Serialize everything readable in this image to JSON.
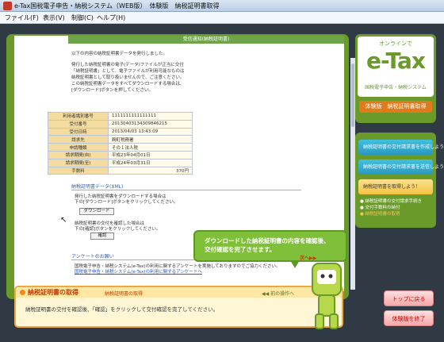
{
  "window": {
    "title": "e-Tax国税電子申告・納税システム（WEB版）　体験版　納税証明書取得"
  },
  "menu": [
    {
      "label": "ファイル(F)"
    },
    {
      "label": "表示(V)"
    },
    {
      "label": "制御(C)"
    },
    {
      "label": "ヘルプ(H)"
    }
  ],
  "content": {
    "header": "受信通知(納税証明書)",
    "intro_lines": [
      "以下の内容の納税証明書データを発行しました。",
      "発行した納税証明書の電子(データ)ファイルが正当に交付",
      "「納税証明書」として、電子ファイルが利用可能なものは",
      "納税証明書として取り扱いませんので、ご注意ください。",
      "この納税証明書データをすべてダウンロードする場合は、",
      "[ダウンロード]ボタンを押してください。"
    ],
    "table": [
      {
        "key": "利用者識別番号",
        "value": "1111111111111111"
      },
      {
        "key": "受付番号",
        "value": "20130403134309846215"
      },
      {
        "key": "受付日時",
        "value": "2013/04/03 13:43:09"
      },
      {
        "key": "請求先",
        "value": "麹町税務署"
      },
      {
        "key": "申請種類",
        "value": "その１法人税"
      },
      {
        "key": "請求期間(自)",
        "value": "平成23年04月01日"
      },
      {
        "key": "請求期間(至)",
        "value": "平成24年03月31日"
      },
      {
        "key": "手数料",
        "value": "370円"
      }
    ],
    "data_section_title": "納税証明書データ(XML)",
    "data_line1": "発行した納税証明書をダウンロードする場合は",
    "data_line2": "下の[ダウンロード]ボタンをクリックしてください。",
    "download_button": "ダウンロード",
    "confirm_line1": "納税証明書の交付を確認した場合は",
    "confirm_line2": "下の[確認]ボタンをクリックしてください。",
    "confirm_button": "確認",
    "survey_title": "アンケートのお願い",
    "survey_text": "国税電子申告・納税システム(e-Tax)の利用に関するアンケートを実施しておりますのでご協力ください。",
    "survey_link": "国税電子申告・納税システム(e-Tax)の利用に関するアンケートへ"
  },
  "bubble": {
    "line1": "ダウンロードした納税証明書の内容を確認後、",
    "line2": "交付確認を完了させます。",
    "next": "次へ▶▶"
  },
  "bottom": {
    "title": "納税証明書の取得",
    "subtitle": "納税証明書の取得",
    "prev": "◀◀ 前の操作へ",
    "description": "納税証明書の交付を確認後、「確認」をクリックして交付確認を完了してください。"
  },
  "sidebar": {
    "logo_top": "オンラインで",
    "logo_main": "e-Tax",
    "logo_sub": "国税電子申告・納税システム",
    "trial_label": "体験版　納税証明書取得",
    "steps": [
      {
        "label": "納税証明書の交付請求書を作成しよう！"
      },
      {
        "label": "納税証明書の交付請求書を送信しよう！"
      },
      {
        "label": "納税証明書を取得しよう！"
      }
    ],
    "sub_items": [
      "● 納税証明書の交付請求手続き",
      "● 交付手数料の納付",
      "● 納税証明書の取得"
    ],
    "top_button": "トップに戻る",
    "end_button": "体験版を終了"
  },
  "colors": {
    "brand_green": "#6a9a2a",
    "accent_orange": "#f08a1c"
  }
}
